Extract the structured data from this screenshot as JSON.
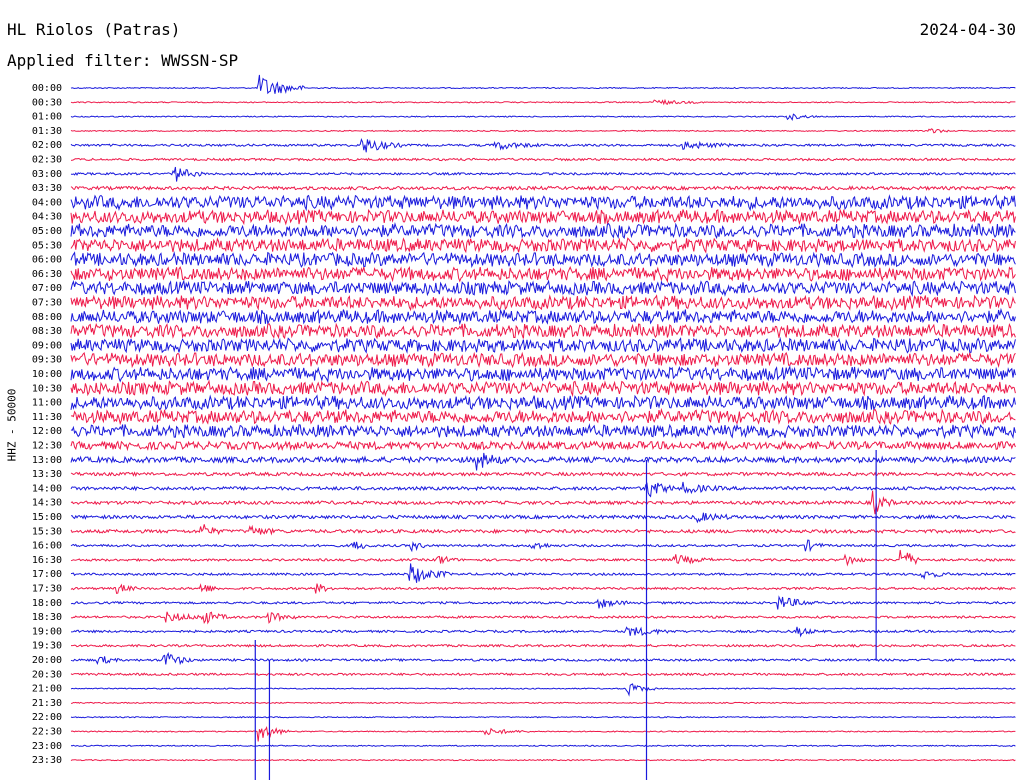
{
  "header": {
    "station": "HL Riolos (Patras)",
    "date": "2024-04-30",
    "filter": "Applied filter: WWSSN-SP"
  },
  "channel_label": "HHZ - 50000",
  "colors": {
    "trace_a": "#1a1adc",
    "trace_b": "#ee1a4a",
    "background": "#ffffff",
    "text": "#000000"
  },
  "chart_data": {
    "type": "helicorder",
    "row_labels": [
      "00:00",
      "00:30",
      "01:00",
      "01:30",
      "02:00",
      "02:30",
      "03:00",
      "03:30",
      "04:00",
      "04:30",
      "05:00",
      "05:30",
      "06:00",
      "06:30",
      "07:00",
      "07:30",
      "08:00",
      "08:30",
      "09:00",
      "09:30",
      "10:00",
      "10:30",
      "11:00",
      "11:30",
      "12:00",
      "12:30",
      "13:00",
      "13:30",
      "14:00",
      "14:30",
      "15:00",
      "15:30",
      "16:00",
      "16:30",
      "17:00",
      "17:30",
      "18:00",
      "18:30",
      "19:00",
      "19:30",
      "20:00",
      "20:30",
      "21:00",
      "21:30",
      "22:00",
      "22:30",
      "23:00",
      "23:30"
    ],
    "trace_colors": [
      "blue",
      "red"
    ],
    "noise_level": [
      1,
      1,
      1,
      1,
      2,
      2,
      2,
      3,
      9,
      9,
      9,
      9,
      9,
      9,
      9,
      9,
      9,
      9,
      9,
      9,
      9,
      9,
      9,
      9,
      8,
      7,
      5,
      3,
      3,
      3,
      3,
      3,
      2,
      2,
      2,
      2,
      2,
      2,
      2,
      2,
      2,
      2,
      1,
      1,
      1,
      1,
      1,
      1
    ],
    "events": [
      {
        "row": 0,
        "x": 0.2,
        "amp": 8,
        "dur": 0.05
      },
      {
        "row": 1,
        "x": 0.62,
        "amp": 1.5,
        "dur": 0.05
      },
      {
        "row": 2,
        "x": 0.76,
        "amp": 2,
        "dur": 0.03
      },
      {
        "row": 3,
        "x": 0.91,
        "amp": 2,
        "dur": 0.02
      },
      {
        "row": 4,
        "x": 0.31,
        "amp": 5,
        "dur": 0.04
      },
      {
        "row": 4,
        "x": 0.45,
        "amp": 2.5,
        "dur": 0.05
      },
      {
        "row": 4,
        "x": 0.65,
        "amp": 2.5,
        "dur": 0.05
      },
      {
        "row": 6,
        "x": 0.11,
        "amp": 5,
        "dur": 0.03
      },
      {
        "row": 26,
        "x": 0.43,
        "amp": 5,
        "dur": 0.03
      },
      {
        "row": 28,
        "x": 0.61,
        "amp": 6,
        "dur": 0.03
      },
      {
        "row": 28,
        "x": 0.65,
        "amp": 3,
        "dur": 0.04
      },
      {
        "row": 29,
        "x": 0.85,
        "amp": 7,
        "dur": 0.02
      },
      {
        "row": 30,
        "x": 0.66,
        "amp": 3,
        "dur": 0.04
      },
      {
        "row": 31,
        "x": 0.14,
        "amp": 4,
        "dur": 0.02
      },
      {
        "row": 31,
        "x": 0.19,
        "amp": 3,
        "dur": 0.03
      },
      {
        "row": 32,
        "x": 0.3,
        "amp": 3,
        "dur": 0.02
      },
      {
        "row": 32,
        "x": 0.36,
        "amp": 3,
        "dur": 0.02
      },
      {
        "row": 32,
        "x": 0.49,
        "amp": 3,
        "dur": 0.02
      },
      {
        "row": 32,
        "x": 0.78,
        "amp": 3,
        "dur": 0.02
      },
      {
        "row": 33,
        "x": 0.39,
        "amp": 3,
        "dur": 0.02
      },
      {
        "row": 33,
        "x": 0.64,
        "amp": 3,
        "dur": 0.04
      },
      {
        "row": 33,
        "x": 0.82,
        "amp": 4,
        "dur": 0.02
      },
      {
        "row": 33,
        "x": 0.88,
        "amp": 8,
        "dur": 0.02
      },
      {
        "row": 34,
        "x": 0.36,
        "amp": 7,
        "dur": 0.04
      },
      {
        "row": 34,
        "x": 0.9,
        "amp": 3,
        "dur": 0.03
      },
      {
        "row": 35,
        "x": 0.05,
        "amp": 3,
        "dur": 0.02
      },
      {
        "row": 35,
        "x": 0.14,
        "amp": 3,
        "dur": 0.02
      },
      {
        "row": 35,
        "x": 0.26,
        "amp": 3,
        "dur": 0.02
      },
      {
        "row": 36,
        "x": 0.56,
        "amp": 3,
        "dur": 0.03
      },
      {
        "row": 36,
        "x": 0.75,
        "amp": 4,
        "dur": 0.04
      },
      {
        "row": 37,
        "x": 0.1,
        "amp": 3,
        "dur": 0.05
      },
      {
        "row": 37,
        "x": 0.14,
        "amp": 4,
        "dur": 0.03
      },
      {
        "row": 37,
        "x": 0.21,
        "amp": 3,
        "dur": 0.03
      },
      {
        "row": 38,
        "x": 0.59,
        "amp": 3,
        "dur": 0.05
      },
      {
        "row": 38,
        "x": 0.77,
        "amp": 3,
        "dur": 0.02
      },
      {
        "row": 40,
        "x": 0.03,
        "amp": 3,
        "dur": 0.02
      },
      {
        "row": 40,
        "x": 0.1,
        "amp": 5,
        "dur": 0.03
      },
      {
        "row": 42,
        "x": 0.59,
        "amp": 4,
        "dur": 0.03
      },
      {
        "row": 45,
        "x": 0.2,
        "amp": 6,
        "dur": 0.03
      },
      {
        "row": 45,
        "x": 0.44,
        "amp": 2,
        "dur": 0.05
      }
    ]
  }
}
